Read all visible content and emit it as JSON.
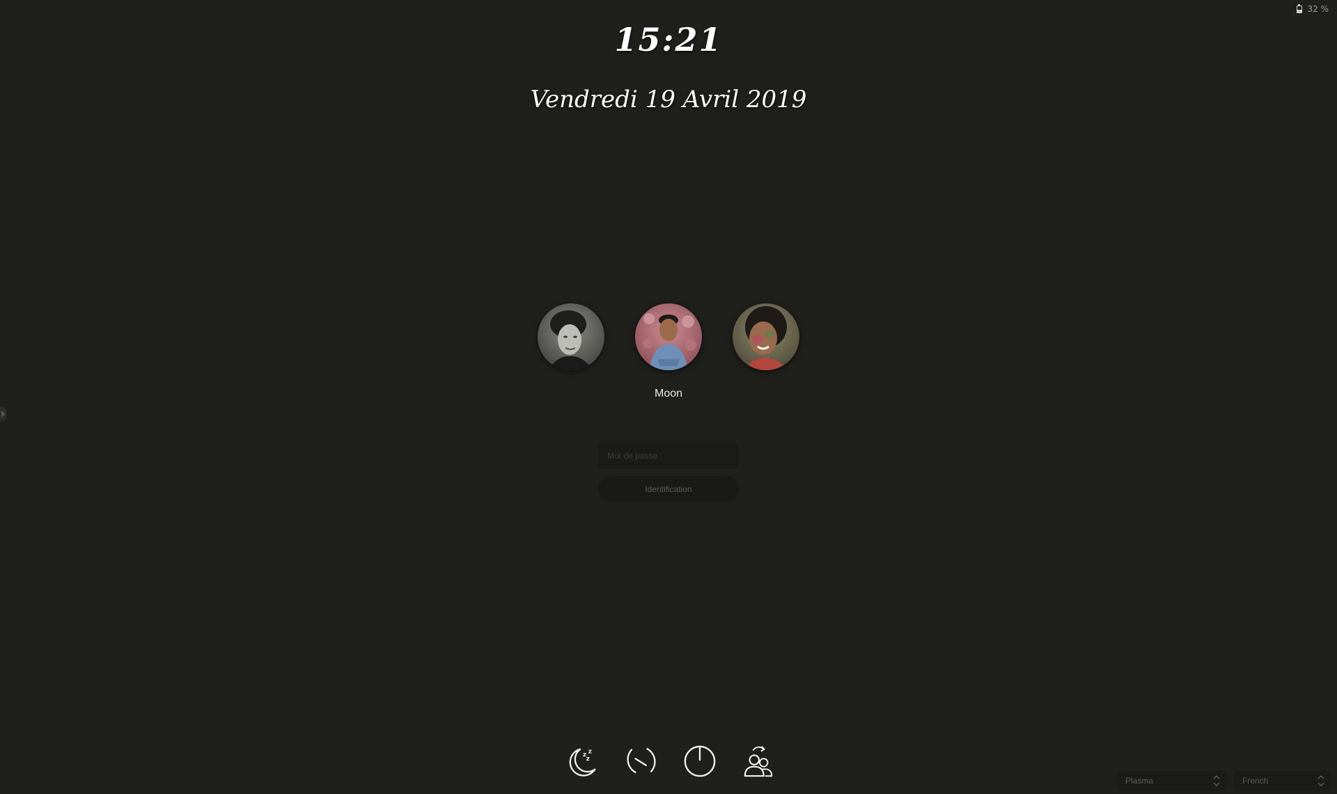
{
  "status": {
    "battery_text": "32 %"
  },
  "clock": {
    "time": "15:21",
    "date": "Vendredi 19 Avril 2019"
  },
  "users": [
    {
      "name": "",
      "photo": "user-photo-1"
    },
    {
      "name": "Moon",
      "photo": "user-photo-2",
      "selected": true
    },
    {
      "name": "",
      "photo": "user-photo-3"
    }
  ],
  "selected_user": {
    "name": "Moon"
  },
  "login": {
    "password_placeholder": "Mot de passe",
    "password_value": "",
    "button_label": "Identification"
  },
  "actions": [
    {
      "name": "suspend",
      "icon": "sleep-moon-icon"
    },
    {
      "name": "reboot",
      "icon": "reboot-icon"
    },
    {
      "name": "shutdown",
      "icon": "power-icon"
    },
    {
      "name": "switch-user",
      "icon": "switch-user-icon"
    }
  ],
  "session_selector": {
    "value": "Plasma"
  },
  "language_selector": {
    "value": "French"
  },
  "colors": {
    "background": "#1f1f1c",
    "text": "#ffffff",
    "muted": "#5b5b57"
  }
}
